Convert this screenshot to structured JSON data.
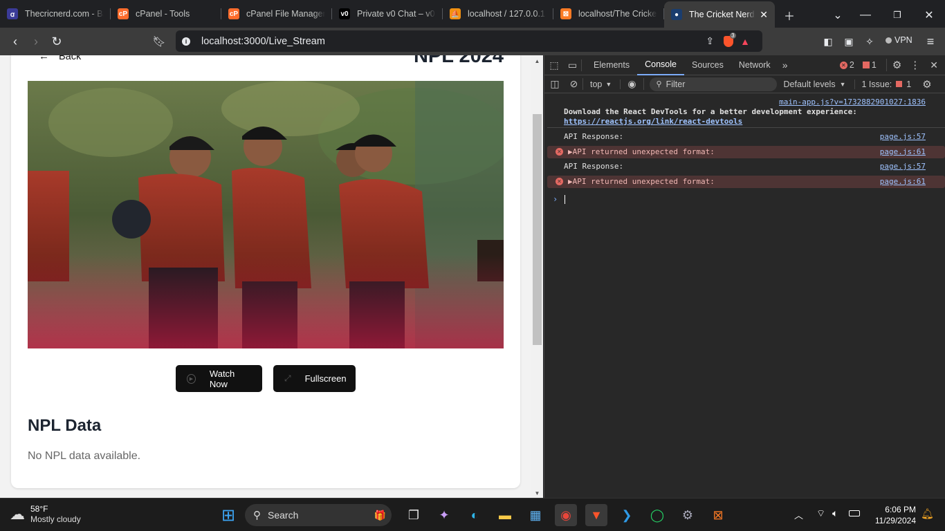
{
  "tabs": [
    {
      "title": "Thecricnerd.com - Ba",
      "fav_color": "#3b3b98",
      "fav_text": "ꭤ"
    },
    {
      "title": "cPanel - Tools",
      "fav_color": "#ff6c2c",
      "fav_text": "cP"
    },
    {
      "title": "cPanel File Manager",
      "fav_color": "#ff6c2c",
      "fav_text": "cP"
    },
    {
      "title": "Private v0 Chat – v0",
      "fav_color": "#000000",
      "fav_text": "v0"
    },
    {
      "title": "localhost / 127.0.0.1",
      "fav_color": "#f29111",
      "fav_text": "⛵"
    },
    {
      "title": "localhost/The Cricket",
      "fav_color": "#fb7a24",
      "fav_text": "⊠"
    },
    {
      "title": "The Cricket Nerd",
      "fav_color": "#1a3d6e",
      "fav_text": "●",
      "active": true
    }
  ],
  "browser": {
    "url": "localhost:3000/Live_Stream",
    "shield_badge": "3",
    "vpn_label": "VPN"
  },
  "page": {
    "back_label": "Back",
    "title": "NPL 2024",
    "watch_label": "Watch Now",
    "fullscreen_label": "Fullscreen",
    "section_title": "NPL Data",
    "empty_text": "No NPL data available."
  },
  "devtools": {
    "tabs": [
      "Elements",
      "Console",
      "Sources",
      "Network"
    ],
    "active_tab": "Console",
    "error_count": "2",
    "warning_count": "1",
    "context": "top",
    "filter_placeholder": "Filter",
    "levels": "Default levels",
    "issues_label": "1 Issue:",
    "issues_count": "1",
    "messages": [
      {
        "type": "info",
        "src": "main-app.js?v=1732882901027:1836",
        "text": "Download the React DevTools for a better development experience:",
        "link": "https://reactjs.org/link/react-devtools"
      },
      {
        "type": "log",
        "text": "API Response:",
        "src": "page.js:57"
      },
      {
        "type": "error",
        "text": "▶API returned unexpected format:",
        "src": "page.js:61"
      },
      {
        "type": "log",
        "text": "API Response:",
        "src": "page.js:57"
      },
      {
        "type": "error",
        "text": "▶API returned unexpected format:",
        "src": "page.js:61"
      }
    ]
  },
  "taskbar": {
    "weather_temp": "58°F",
    "weather_desc": "Mostly cloudy",
    "search_placeholder": "Search",
    "time": "6:06 PM",
    "date": "11/29/2024"
  }
}
